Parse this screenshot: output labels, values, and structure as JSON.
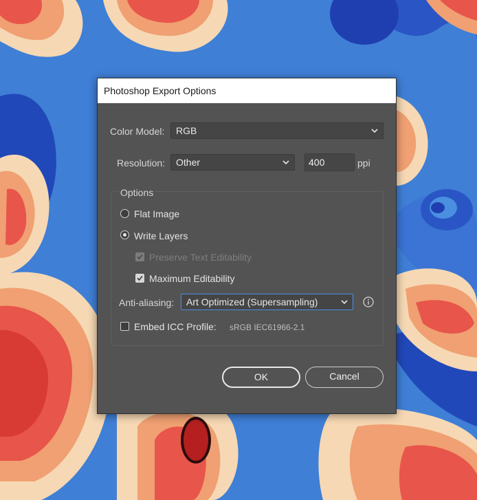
{
  "dialog": {
    "title": "Photoshop Export Options",
    "color_model": {
      "label": "Color Model:",
      "value": "RGB"
    },
    "resolution": {
      "label": "Resolution:",
      "value": "Other",
      "ppi_value": "400",
      "unit": "ppi"
    },
    "options": {
      "group_label": "Options",
      "flat_image": {
        "label": "Flat Image",
        "selected": false
      },
      "write_layers": {
        "label": "Write Layers",
        "selected": true
      },
      "preserve_text": {
        "label": "Preserve Text Editability",
        "checked": true,
        "enabled": false
      },
      "maximum_editability": {
        "label": "Maximum Editability",
        "checked": true
      },
      "anti_aliasing": {
        "label": "Anti-aliasing:",
        "value": "Art Optimized (Supersampling)"
      },
      "embed_icc": {
        "label": "Embed ICC Profile:",
        "checked": false,
        "profile": "sRGB IEC61966-2.1"
      }
    },
    "buttons": {
      "ok": "OK",
      "cancel": "Cancel"
    }
  },
  "colors": {
    "dialog_bg": "#535353",
    "accent_focus": "#4a8fe8",
    "background_blue": "#3f7fd6",
    "paper_red": "#e8554a",
    "paper_orange": "#f0a072",
    "paper_cream": "#f6d8b4"
  },
  "icons": [
    "chevron-down-icon",
    "info-icon",
    "checkmark-icon"
  ]
}
